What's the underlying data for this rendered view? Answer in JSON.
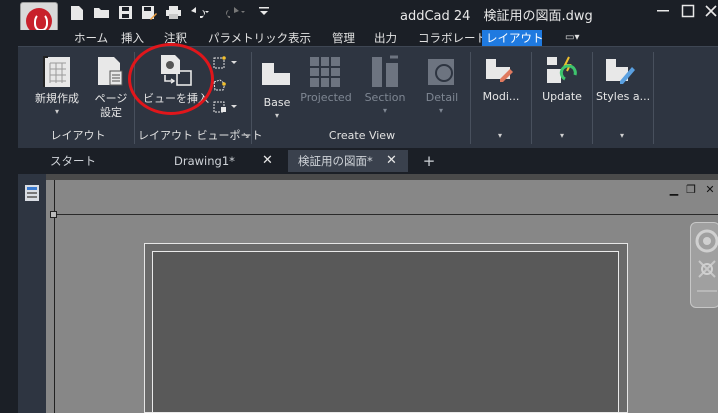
{
  "app": {
    "title": "addCad 24　検証用の図面.dwg",
    "qat_icons": [
      "new-file-icon",
      "open-folder-icon",
      "save-icon",
      "save-as-icon",
      "print-icon",
      "undo-icon",
      "redo-icon",
      "customize-qat-icon"
    ],
    "window_controls": [
      "minimize-icon",
      "restore-icon",
      "close-icon"
    ]
  },
  "menu": {
    "tabs": [
      "ホーム",
      "挿入",
      "注釈",
      "パラメトリック",
      "表示",
      "管理",
      "出力",
      "コラボレート",
      "レイアウト"
    ],
    "active_tab": "レイアウト",
    "extra_toggle": "▭▾"
  },
  "ribbon": {
    "layout_panel": {
      "title": "レイアウト",
      "new_layout_label": "新規作成",
      "page_setup_label": "ページ\n設定"
    },
    "viewport_panel": {
      "title": "レイアウト ビューポート",
      "insert_view_label": "ビューを挿入"
    },
    "create_view_panel": {
      "title": "Create View",
      "base_label": "Base",
      "projected_label": "Projected",
      "section_label": "Section",
      "detail_label": "Detail"
    },
    "modify_label": "Modi...",
    "update_label": "Update",
    "styles_label": "Styles a..."
  },
  "doc_tabs": [
    {
      "label": "スタート",
      "active": false,
      "closable": false
    },
    {
      "label": "Drawing1*",
      "active": false,
      "closable": true
    },
    {
      "label": "検証用の図面*",
      "active": true,
      "closable": true
    }
  ],
  "colors": {
    "background": "#1b1f26",
    "ribbon": "#2e3541",
    "active_tab": "#1f7ae0",
    "canvas": "#878787",
    "annotation": "#e0161b"
  }
}
